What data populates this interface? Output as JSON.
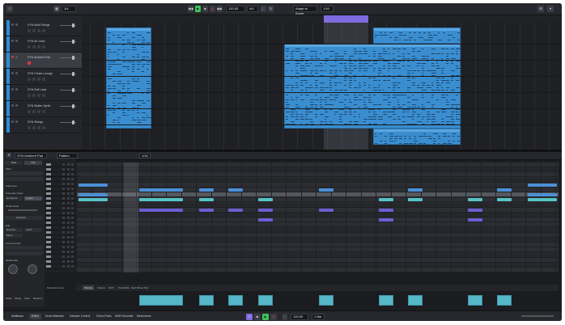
{
  "transport": {
    "bpm": "120.00",
    "time_sig": "4/4",
    "key_label": "Adapt to Zoom",
    "grid_value": "1/16",
    "bottom_bpm": "120.00",
    "bottom_beat": "1 Bar"
  },
  "arrangement": {
    "tracks": [
      {
        "name": "SYN Multi Strings"
      },
      {
        "name": "SYN Arr Lead"
      },
      {
        "name": "SYN Ambient Pad"
      },
      {
        "name": "SYN Choke Lounge"
      },
      {
        "name": "SYN Soft Lead"
      },
      {
        "name": "SYN Stutter Synth"
      },
      {
        "name": "SYN Strings"
      }
    ]
  },
  "editor": {
    "track_name": "SYN Ambient Pad",
    "mode": "Pattern",
    "quantize": "1/16",
    "zoom": "1/4",
    "inspector": {
      "tabs": [
        "Note",
        "Clip"
      ],
      "sections": [
        "Pitch",
        "Fold Lines",
        "Automate Notes",
        "Chord Tools",
        "Edit",
        "Loop Controls",
        "Randomize"
      ],
      "buttons": [
        "Humanize",
        "Legato",
        "Quantize",
        "Reverse",
        "Invert",
        "Mirror"
      ],
      "bottom_labels": [
        "Scale",
        "Swing",
        "Gate",
        "Random"
      ]
    },
    "view_tabs": [
      "Velocity",
      "Chance",
      "Pitch",
      "Probability",
      "Mod Wheel",
      "Pan"
    ],
    "lane_label": "Parameter Lane"
  },
  "bottom_tabs": [
    "Multitrack",
    "Editor",
    "Drum Machine",
    "Sampler Control",
    "Chord Pads",
    "MIDI Recorder",
    "Metronome"
  ],
  "colors": {
    "clip_blue": "#3a8ed0",
    "note_blue": "#4b8fd6",
    "note_teal": "#58c3c6",
    "note_purple": "#6a5fd0",
    "accent_purple": "#7f6be0",
    "record_red": "#d83b3b",
    "play_green": "#42c25a"
  },
  "icons": [
    "play-icon",
    "stop-icon",
    "record-icon",
    "loop-icon",
    "metronome-icon",
    "rewind-icon",
    "forward-icon",
    "settings-icon",
    "chevron-down-icon"
  ]
}
